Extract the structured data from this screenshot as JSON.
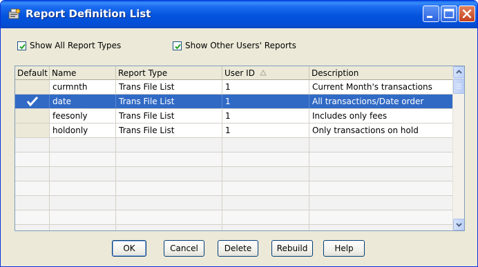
{
  "window": {
    "title": "Report Definition List",
    "colors": {
      "titlebar": "#0453dd",
      "selection": "#316ac5",
      "face": "#ece9d8"
    },
    "controls": [
      "minimize-icon",
      "maximize-icon",
      "close-icon"
    ]
  },
  "filters": {
    "show_all_types": {
      "label": "Show All Report Types",
      "checked": true
    },
    "show_other_users": {
      "label": "Show Other Users' Reports",
      "checked": true
    }
  },
  "grid": {
    "columns": [
      "Default",
      "Name",
      "Report Type",
      "User ID",
      "Description"
    ],
    "sort_column": "User ID",
    "rows": [
      {
        "default": "",
        "name": "curmnth",
        "type": "Trans File List",
        "user": "1",
        "desc": "Current Month's transactions",
        "selected": false
      },
      {
        "default": "✔",
        "name": "date",
        "type": "Trans File List",
        "user": "1",
        "desc": "All transactions/Date order",
        "selected": true
      },
      {
        "default": "",
        "name": "feesonly",
        "type": "Trans File List",
        "user": "1",
        "desc": "Includes only fees",
        "selected": false
      },
      {
        "default": "",
        "name": "holdonly",
        "type": "Trans File List",
        "user": "1",
        "desc": "Only transactions on hold",
        "selected": false
      }
    ]
  },
  "buttons": {
    "ok": "OK",
    "cancel": "Cancel",
    "delete": "Delete",
    "rebuild": "Rebuild",
    "help": "Help"
  }
}
